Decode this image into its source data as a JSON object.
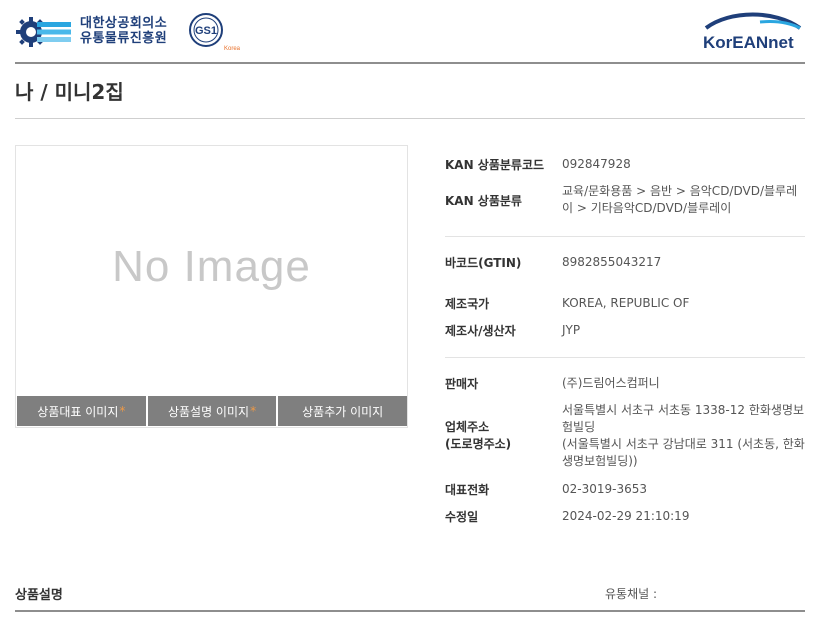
{
  "header": {
    "kcci_line1": "대한상공회의소",
    "kcci_line2": "유통물류진흥원",
    "gs1_text": "GS1",
    "gs1_sub": "Korea",
    "koreannet_logo": "KorEANnet"
  },
  "page": {
    "title": "나 / 미니2집"
  },
  "image_panel": {
    "placeholder": "No Image",
    "tabs": [
      {
        "label": "상품대표 이미지",
        "required": "*"
      },
      {
        "label": "상품설명 이미지",
        "required": "*"
      },
      {
        "label": "상품추가 이미지",
        "required": ""
      }
    ]
  },
  "info": {
    "kan_code": {
      "label": "KAN 상품분류코드",
      "value": "092847928"
    },
    "kan_category": {
      "label": "KAN 상품분류",
      "value": "교육/문화용품 > 음반 > 음악CD/DVD/블루레이 > 기타음악CD/DVD/블루레이"
    },
    "barcode": {
      "label": "바코드(GTIN)",
      "value": "8982855043217"
    },
    "country": {
      "label": "제조국가",
      "value": "KOREA, REPUBLIC OF"
    },
    "maker": {
      "label": "제조사/생산자",
      "value": "JYP"
    },
    "seller": {
      "label": "판매자",
      "value": "(주)드림어스컴퍼니"
    },
    "address": {
      "label1": "업체주소",
      "label2": "(도로명주소)",
      "value1": "서울특별시 서초구 서초동 1338-12 한화생명보험빌딩",
      "value2": "(서울특별시 서초구 강남대로 311 (서초동, 한화생명보험빌딩))"
    },
    "phone": {
      "label": "대표전화",
      "value": "02-3019-3653"
    },
    "modified": {
      "label": "수정일",
      "value": "2024-02-29 21:10:19"
    }
  },
  "bottom": {
    "desc_title": "상품설명",
    "channel_label": "유통채널 :"
  },
  "colors": {
    "brand_blue": "#1f3f7a",
    "tab_gray": "#7f7f7f",
    "star_orange": "#f09a46"
  }
}
